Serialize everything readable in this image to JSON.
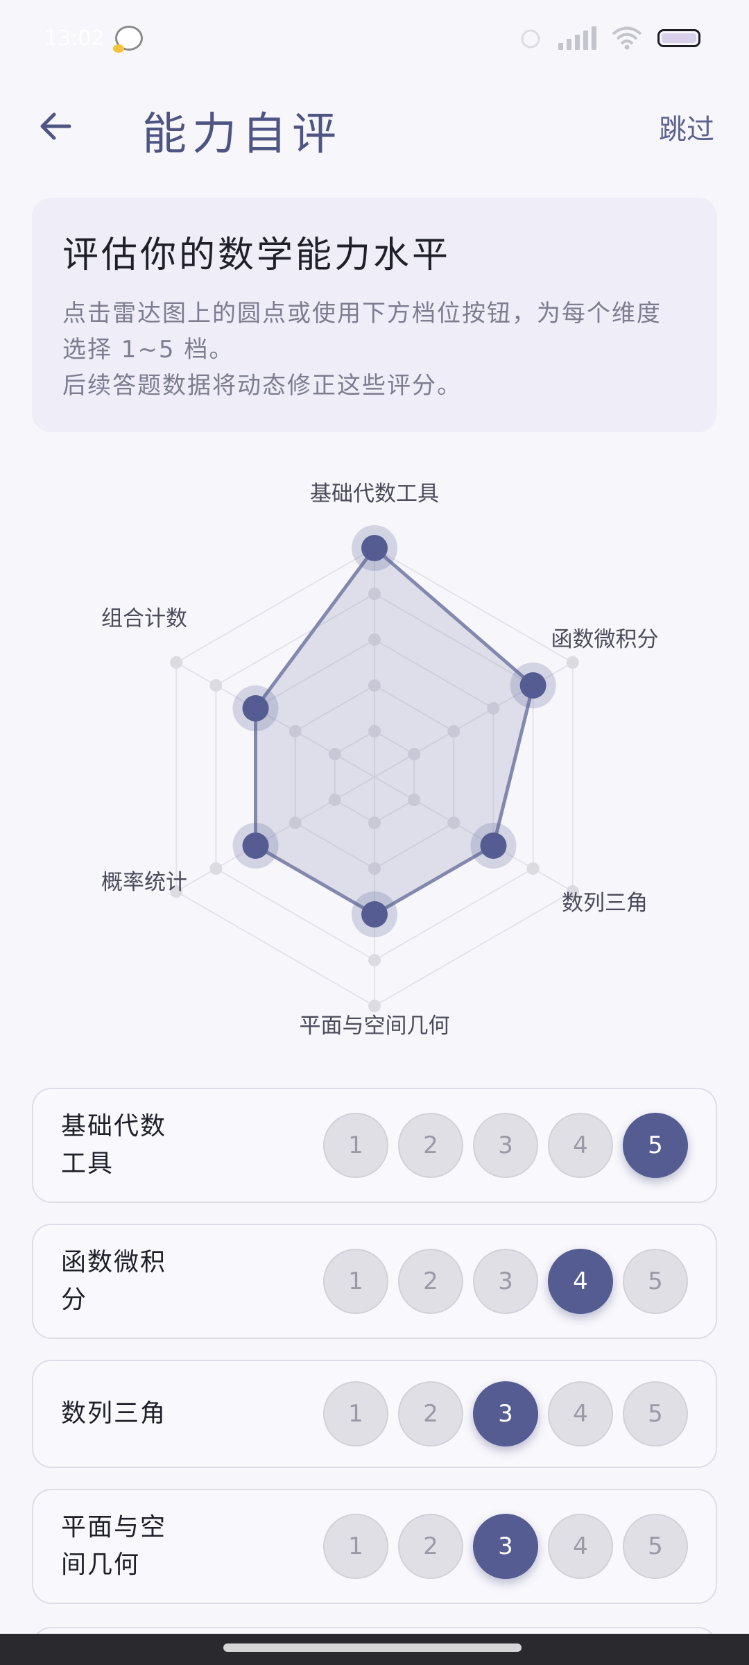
{
  "status_bar": {
    "time": "13:02",
    "icons": [
      "mascot-icon",
      "alarm-icon",
      "signal-icon",
      "wifi-icon",
      "battery-icon"
    ]
  },
  "header": {
    "title": "能力自评",
    "skip_label": "跳过",
    "back_icon": "arrow-left-icon"
  },
  "intro": {
    "title": "评估你的数学能力水平",
    "desc_line1": "点击雷达图上的圆点或使用下方档位按钮，为每个维度",
    "desc_line2": "选择 1~5 档。",
    "desc_line3": "后续答题数据将动态修正这些评分。"
  },
  "radar": {
    "max_level": 5,
    "accent": "#545c92",
    "dimensions": [
      {
        "name": "基础代数工具",
        "value": 5
      },
      {
        "name": "函数微积分",
        "value": 4
      },
      {
        "name": "数列三角",
        "value": 3
      },
      {
        "name": "平面与空间几何",
        "value": 3
      },
      {
        "name": "概率统计",
        "value": 3
      },
      {
        "name": "组合计数",
        "value": 3
      }
    ]
  },
  "levels": {
    "options": [
      "1",
      "2",
      "3",
      "4",
      "5"
    ],
    "rows": [
      {
        "label_line1": "基础代数",
        "label_line2": "工具",
        "selected": 5
      },
      {
        "label_line1": "函数微积",
        "label_line2": "分",
        "selected": 4
      },
      {
        "label_line1": "数列三角",
        "label_line2": "",
        "selected": 3
      },
      {
        "label_line1": "平面与空",
        "label_line2": "间几何",
        "selected": 3
      }
    ]
  }
}
